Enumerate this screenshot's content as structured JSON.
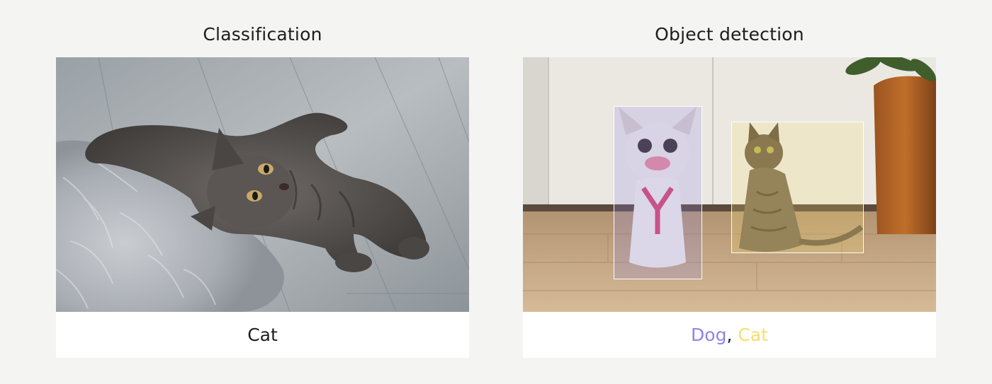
{
  "panels": {
    "classification": {
      "title": "Classification",
      "label": "Cat"
    },
    "detection": {
      "title": "Object detection",
      "labels": [
        {
          "text": "Dog",
          "color": "#8b86ea"
        },
        {
          "text": "Cat",
          "color": "#f5df6c"
        }
      ],
      "separator": ", "
    }
  },
  "colors": {
    "background": "#f4f4f3",
    "caption_background": "#ffffff",
    "dog_box_tint": "#8b86ea",
    "cat_box_tint": "#f5df6c"
  }
}
